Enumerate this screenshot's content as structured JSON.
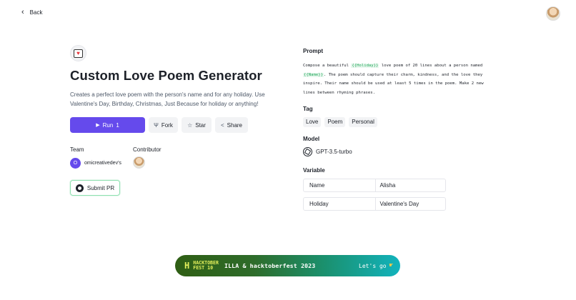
{
  "nav": {
    "back_label": "Back"
  },
  "app": {
    "title": "Custom Love Poem Generator",
    "description": "Creates a perfect love poem with the person's name and for any holiday. Use Valentine's Day, Birthday, Christmas, Just Because for holiday or anything!",
    "icon": "love-poem-icon"
  },
  "actions": {
    "run_label": "Run",
    "run_count": "1",
    "fork_label": "Fork",
    "star_label": "Star",
    "share_label": "Share"
  },
  "team": {
    "label": "Team",
    "name": "omicreativedev's",
    "initial": "O"
  },
  "contributor": {
    "label": "Contributor"
  },
  "submit_pr": {
    "label": "Submit PR"
  },
  "prompt": {
    "label": "Prompt",
    "part1": "Compose a beautiful ",
    "var1": "{{Holiday}}",
    "part2": " love poem of 20 lines about a person named ",
    "var2": "{{Name}}",
    "part3": ". The poem should capture their charm, kindness, and the love they inspire. Their name should be used at least 5 times in the poem. Make 2 new lines between rhyming phrases."
  },
  "tags": {
    "label": "Tag",
    "items": [
      "Love",
      "Poem",
      "Personal"
    ]
  },
  "model": {
    "label": "Model",
    "name": "GPT-3.5-turbo",
    "icon": "openai-icon"
  },
  "variables": {
    "label": "Variable",
    "rows": [
      {
        "key": "Name",
        "value": "Alisha"
      },
      {
        "key": "Holiday",
        "value": "Valentine's Day"
      }
    ]
  },
  "banner": {
    "logo_text_1": "HACKTOBER",
    "logo_text_2": "FEST",
    "logo_num": "10",
    "text": "ILLA & hacktoberfest 2023",
    "cta": "Let's go",
    "colors": {
      "start": "#2f5e14",
      "end": "#12b3bd",
      "accent": "#e4f05c"
    }
  },
  "colors": {
    "primary": "#654aec",
    "variable_green": "#22a85b",
    "pr_border": "#8fe0b0"
  }
}
